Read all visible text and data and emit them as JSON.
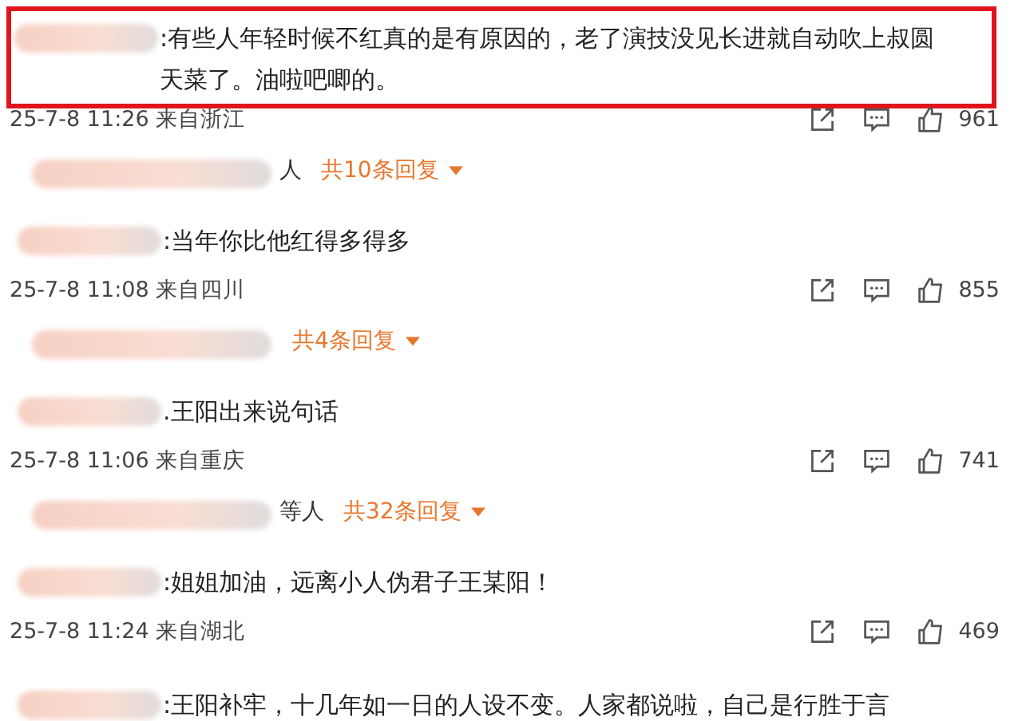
{
  "comments": [
    {
      "highlighted": true,
      "text": ":有些人年轻时候不红真的是有原因的，老了演技没见长进就自动吹上叔圆天菜了。油啦吧唧的。",
      "time": "25-7-8 11:26",
      "location": "来自浙江",
      "likes": "961",
      "replies": {
        "names": "人",
        "count": "共10条回复"
      }
    },
    {
      "highlighted": false,
      "text": ":当年你比他红得多得多",
      "time": "25-7-8 11:08",
      "location": "来自四川",
      "likes": "855",
      "replies": {
        "count": "共4条回复"
      }
    },
    {
      "highlighted": false,
      "text": ".王阳出来说句话",
      "time": "25-7-8 11:06",
      "location": "来自重庆",
      "likes": "741",
      "replies": {
        "names": "等人",
        "count": "共32条回复"
      }
    },
    {
      "highlighted": false,
      "text": ":姐姐加油，远离小人伪君子王某阳！",
      "time": "25-7-8 11:24",
      "location": "来自湖北",
      "likes": "469"
    },
    {
      "highlighted": false,
      "text": ":王阳补牢，十几年如一日的人设不变。人家都说啦，自己是行胜于言"
    }
  ]
}
